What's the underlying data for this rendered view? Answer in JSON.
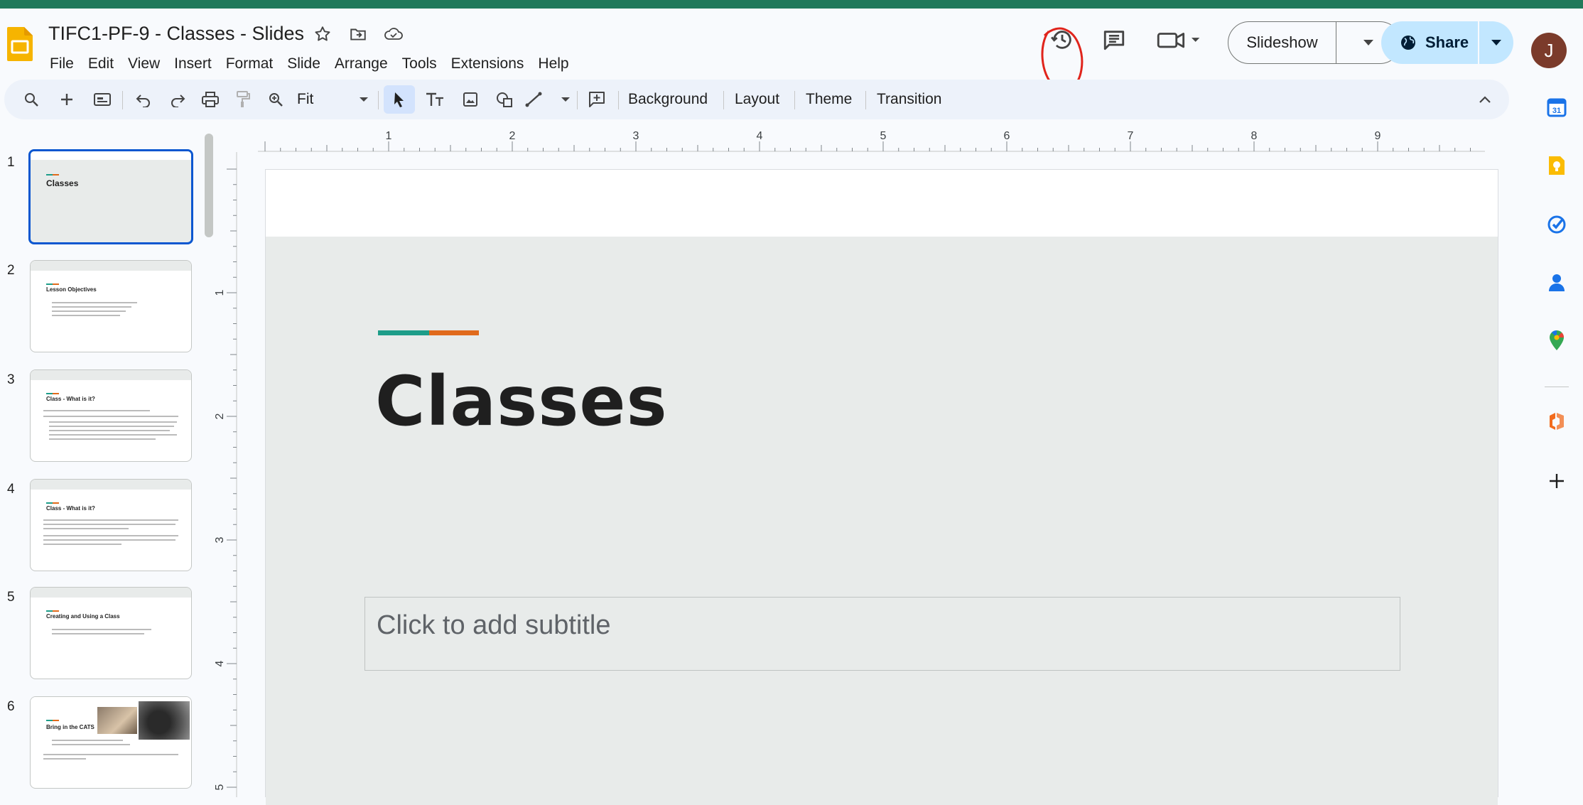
{
  "document": {
    "title": "TIFC1-PF-9 - Classes - Slides"
  },
  "menu": [
    "File",
    "Edit",
    "View",
    "Insert",
    "Format",
    "Slide",
    "Arrange",
    "Tools",
    "Extensions",
    "Help"
  ],
  "header": {
    "slideshow_label": "Slideshow",
    "share_label": "Share",
    "avatar_initial": "J"
  },
  "toolbar": {
    "zoom_value": "Fit",
    "background_label": "Background",
    "layout_label": "Layout",
    "theme_label": "Theme",
    "transition_label": "Transition"
  },
  "ruler": {
    "top_numbers": [
      "1",
      "2",
      "3",
      "4",
      "5",
      "6",
      "7",
      "8",
      "9"
    ],
    "left_numbers": [
      "1",
      "2",
      "3",
      "4",
      "5"
    ]
  },
  "slides": [
    {
      "num": "1",
      "title": "Classes",
      "selected": true
    },
    {
      "num": "2",
      "title": "Lesson Objectives"
    },
    {
      "num": "3",
      "title": "Class - What is it?"
    },
    {
      "num": "4",
      "title": "Class - What is it?"
    },
    {
      "num": "5",
      "title": "Creating and Using a Class"
    },
    {
      "num": "6",
      "title": "Bring in the CATS"
    }
  ],
  "current_slide": {
    "title": "Classes",
    "subtitle_placeholder": "Click to add subtitle"
  },
  "colors": {
    "accent_teal": "#1d9d89",
    "accent_orange": "#e06a1c",
    "selection_blue": "#0b57d0",
    "share_bg": "#c2e7ff"
  }
}
